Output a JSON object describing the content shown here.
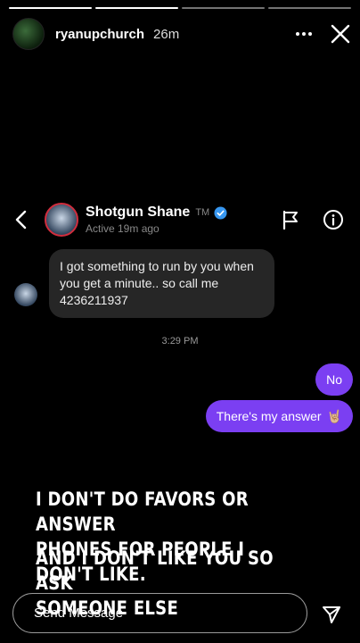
{
  "story": {
    "username": "ryanupchurch",
    "time": "26m",
    "progress_segments": 4,
    "active_segment": 2
  },
  "dm": {
    "name": "Shotgun Shane",
    "tm": "TM",
    "status": "Active 19m ago",
    "messages": {
      "incoming": "I got something to run by you when you get a minute.. so call me 4236211937",
      "timestamp": "3:29 PM",
      "out_1": "No",
      "out_2": "There's my answer",
      "out_2_emoji": "🤘🏼"
    }
  },
  "caption": {
    "line1": "I DON'T DO FAVORS OR ANSWER\nPHONES FOR PEOPLE I DON'T LIKE.",
    "line2": "AND I DON'T LIKE YOU SO ASK\nSOMEONE ELSE"
  },
  "composer": {
    "placeholder": "Send Message"
  },
  "colors": {
    "accent_purple": "#7b3ff2",
    "verified_blue": "#3797f0",
    "incoming_bubble": "#262626"
  },
  "icons": [
    "more-icon",
    "close-icon",
    "back-icon",
    "verified-icon",
    "flag-icon",
    "info-icon",
    "send-icon"
  ]
}
